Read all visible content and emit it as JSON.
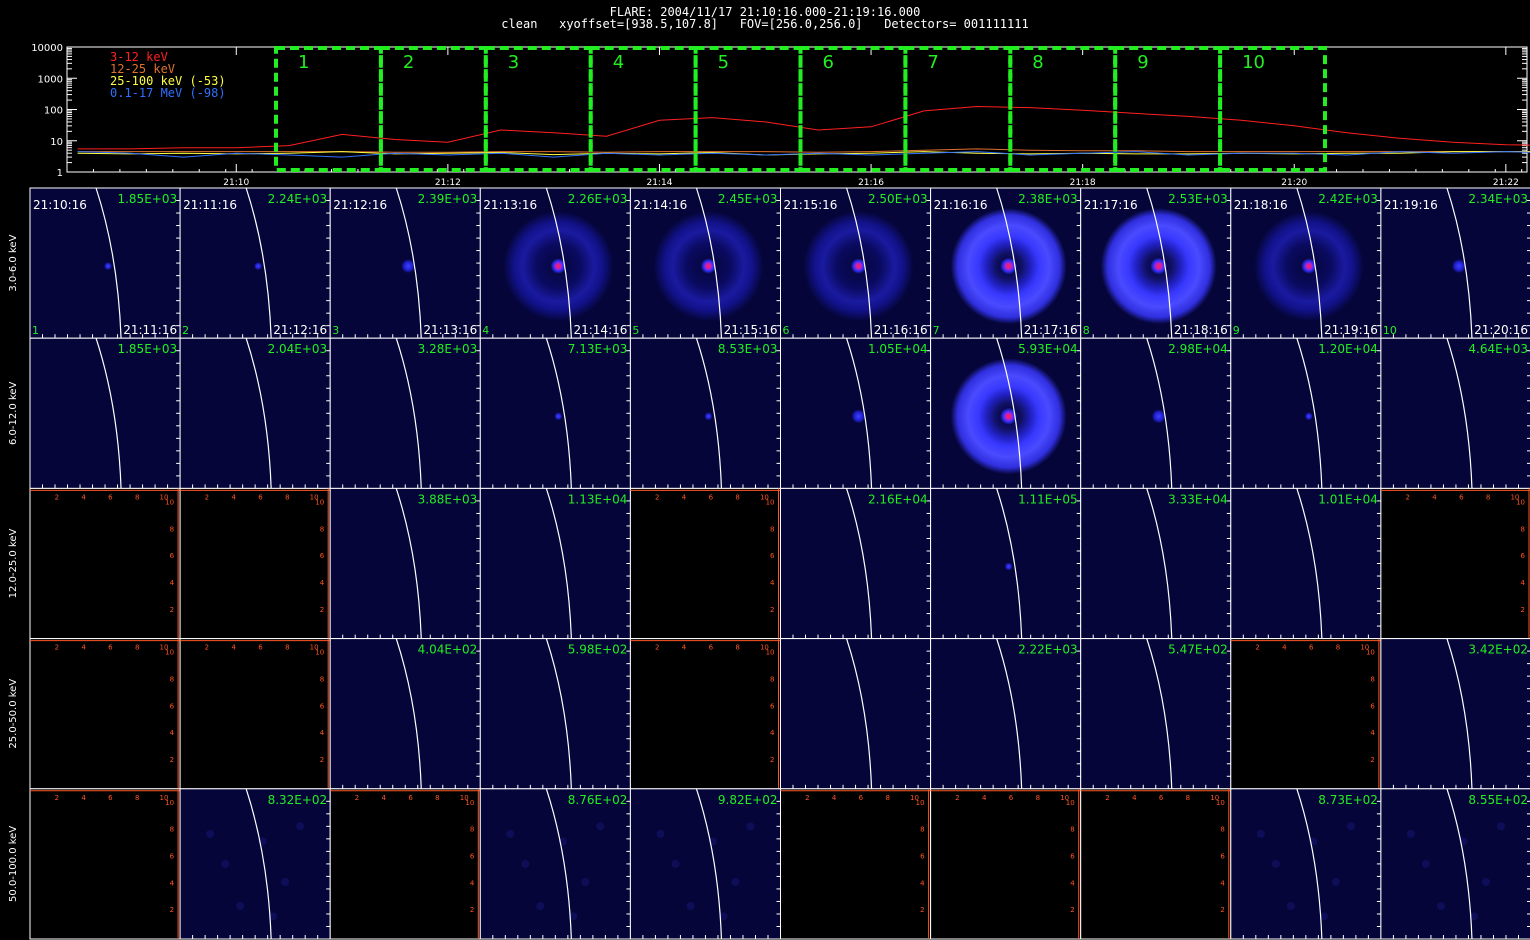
{
  "header": {
    "line1": "FLARE: 2004/11/17 21:10:16.000-21:19:16.000",
    "line2": "clean   xyoffset=[938.5,107.8]   FOV=[256.0,256.0]   Detectors= 001111111"
  },
  "lightcurve": {
    "y_ticks": [
      "10000",
      "1000",
      "100",
      "10",
      "1"
    ],
    "x_ticks": [
      "21:10",
      "21:12",
      "21:14",
      "21:16",
      "21:18",
      "21:20",
      "21:22"
    ],
    "legend": [
      {
        "label": "3-12 keV",
        "color": "#ff2020"
      },
      {
        "label": "12-25 keV",
        "color": "#e07030"
      },
      {
        "label": "25-100 keV (-53)",
        "color": "#ffff40"
      },
      {
        "label": "0.1-17 MeV (-98)",
        "color": "#3070ff"
      }
    ],
    "intervals": [
      "1",
      "2",
      "3",
      "4",
      "5",
      "6",
      "7",
      "8",
      "9",
      "10"
    ],
    "interval_color": "#22ee22"
  },
  "chart_data": {
    "type": "line",
    "title": "FLARE: 2004/11/17 21:10:16.000-21:19:16.000",
    "yscale": "log",
    "ylim": [
      1,
      10000
    ],
    "x": [
      "21:08.5",
      "21:09.0",
      "21:09.5",
      "21:10.0",
      "21:10.5",
      "21:11.0",
      "21:11.5",
      "21:12.0",
      "21:12.5",
      "21:13.0",
      "21:13.5",
      "21:14.0",
      "21:14.5",
      "21:15.0",
      "21:15.5",
      "21:16.0",
      "21:16.5",
      "21:17.0",
      "21:17.5",
      "21:18.0",
      "21:18.5",
      "21:19.0",
      "21:19.5",
      "21:20.0",
      "21:20.5",
      "21:21.0",
      "21:21.5",
      "21:22.0",
      "21:22.5"
    ],
    "series": [
      {
        "name": "3-12 keV",
        "values": [
          5.5,
          5.5,
          6,
          6,
          7,
          16,
          11,
          9,
          22,
          18,
          14,
          45,
          55,
          40,
          22,
          28,
          90,
          125,
          115,
          95,
          75,
          60,
          45,
          30,
          18,
          12,
          9,
          7.5,
          7
        ]
      },
      {
        "name": "12-25 keV",
        "values": [
          4.5,
          4.5,
          4.5,
          4.5,
          4.5,
          4.5,
          4.3,
          4.3,
          4.5,
          4.5,
          4.3,
          4.5,
          4.5,
          4.5,
          4.3,
          4.5,
          5,
          5.5,
          5,
          4.8,
          4.8,
          4.5,
          4.5,
          4.5,
          4.5,
          4.5,
          4.5,
          4.5,
          4.5
        ]
      },
      {
        "name": "25-100 keV (-53)",
        "values": [
          4,
          3.8,
          4,
          3.8,
          4,
          4.5,
          3.8,
          4,
          4.2,
          3.6,
          4,
          3.8,
          4.2,
          3.5,
          3.8,
          4,
          4.5,
          4,
          3.8,
          4,
          3.8,
          3.8,
          4,
          3.8,
          4,
          4,
          4.5,
          4.5,
          4.5
        ]
      },
      {
        "name": "0.1-17 MeV (-98)",
        "values": [
          4.5,
          4,
          3,
          4,
          3.5,
          3,
          4,
          3.5,
          4,
          3,
          4,
          3.5,
          4,
          3.5,
          4,
          3.5,
          4,
          4.5,
          3.5,
          4,
          4.5,
          3.5,
          4,
          4,
          3.5,
          4.5,
          4,
          4.5,
          4
        ]
      }
    ]
  },
  "image_grid": {
    "rows": [
      "3.0-6.0 keV",
      "6.0-12.0 keV",
      "12.0-25.0 keV",
      "25.0-50.0 keV",
      "50.0-100.0 keV"
    ],
    "start_times": [
      "21:10:16",
      "21:11:16",
      "21:12:16",
      "21:13:16",
      "21:14:16",
      "21:15:16",
      "21:16:16",
      "21:17:16",
      "21:18:16",
      "21:19:16"
    ],
    "end_times": [
      "21:11:16",
      "21:12:16",
      "21:13:16",
      "21:14:16",
      "21:15:16",
      "21:16:16",
      "21:17:16",
      "21:18:16",
      "21:19:16",
      "21:20:16"
    ],
    "interval_numbers": [
      "1",
      "2",
      "3",
      "4",
      "5",
      "6",
      "7",
      "8",
      "9",
      "10"
    ],
    "empty_axis_ticks": [
      "2",
      "4",
      "6",
      "8",
      "10"
    ],
    "max_values": [
      [
        "1.85E+03",
        "2.24E+03",
        "2.39E+03",
        "2.26E+03",
        "2.45E+03",
        "2.50E+03",
        "2.38E+03",
        "2.53E+03",
        "2.42E+03",
        "2.34E+03"
      ],
      [
        "1.85E+03",
        "2.04E+03",
        "3.28E+03",
        "7.13E+03",
        "8.53E+03",
        "1.05E+04",
        "5.93E+04",
        "2.98E+04",
        "1.20E+04",
        "4.64E+03"
      ],
      [
        null,
        null,
        "3.88E+03",
        "1.13E+04",
        null,
        "2.16E+04",
        "1.11E+05",
        "3.33E+04",
        "1.01E+04",
        null
      ],
      [
        null,
        null,
        "4.04E+02",
        "5.98E+02",
        null,
        null,
        "2.22E+03",
        "5.47E+02",
        null,
        "3.42E+02"
      ],
      [
        null,
        "8.32E+02",
        null,
        "8.76E+02",
        "9.82E+02",
        null,
        null,
        null,
        "8.73E+02",
        "8.55E+02"
      ]
    ],
    "features": [
      [
        "dot_tiny",
        "dot_tiny",
        "dot_small",
        "ring_faint",
        "ring_faint",
        "ring_faint",
        "ring_bright",
        "ring_bright",
        "ring_faint",
        "dot_small"
      ],
      [
        "none",
        "none",
        "none",
        "dot_tiny",
        "dot_tiny",
        "dot_small",
        "ring_bright",
        "dot_small",
        "dot_tiny",
        "none"
      ],
      [
        "empty",
        "empty",
        "none",
        "none",
        "empty",
        "none",
        "dot_tiny",
        "none",
        "none",
        "empty"
      ],
      [
        "empty",
        "empty",
        "none",
        "none",
        "empty",
        "none",
        "none",
        "none",
        "empty",
        "none"
      ],
      [
        "empty",
        "noise",
        "empty",
        "noise",
        "noise",
        "empty",
        "empty",
        "empty",
        "noise",
        "noise"
      ]
    ],
    "colors": {
      "image_bg": "#05053a",
      "empty_bg": "#000000",
      "axis_orange": "#ff5522",
      "value_green": "#22ee22",
      "limb_white": "#ffffff"
    }
  }
}
